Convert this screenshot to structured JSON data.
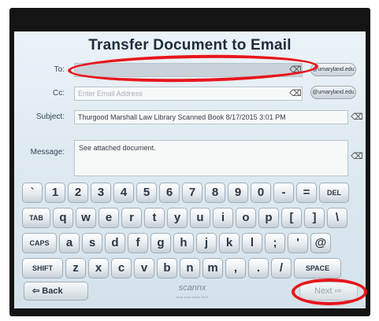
{
  "title": "Transfer Document to Email",
  "to": {
    "label": "To:",
    "value": "",
    "domain_button": "@umaryland.edu"
  },
  "cc": {
    "label": "Cc:",
    "placeholder": "Enter Email Address",
    "domain_button": "@umaryland.edu"
  },
  "subject": {
    "label": "Subject:",
    "value": "Thurgood Marshall Law Library Scanned Book 8/17/2015 3:01 PM"
  },
  "message": {
    "label": "Message:",
    "value": "See attached document."
  },
  "clear_glyph": "⌫",
  "keyboard": {
    "row1": [
      "`",
      "1",
      "2",
      "3",
      "4",
      "5",
      "6",
      "7",
      "8",
      "9",
      "0",
      "-",
      "=",
      "DEL"
    ],
    "row2": [
      "TAB",
      "q",
      "w",
      "e",
      "r",
      "t",
      "y",
      "u",
      "i",
      "o",
      "p",
      "[",
      "]",
      "\\"
    ],
    "row3": [
      "CAPS",
      "a",
      "s",
      "d",
      "f",
      "g",
      "h",
      "j",
      "k",
      "l",
      ";",
      "'",
      "@"
    ],
    "row4": [
      "SHIFT",
      "z",
      "x",
      "c",
      "v",
      "b",
      "n",
      "m",
      ",",
      ".",
      "/",
      "SPACE"
    ]
  },
  "footer": {
    "back_label": "Back",
    "logo_text": "scannx",
    "logo_tagline": "book scan center 2015",
    "next_label": "Next"
  },
  "annotation_color": "#e8151b"
}
